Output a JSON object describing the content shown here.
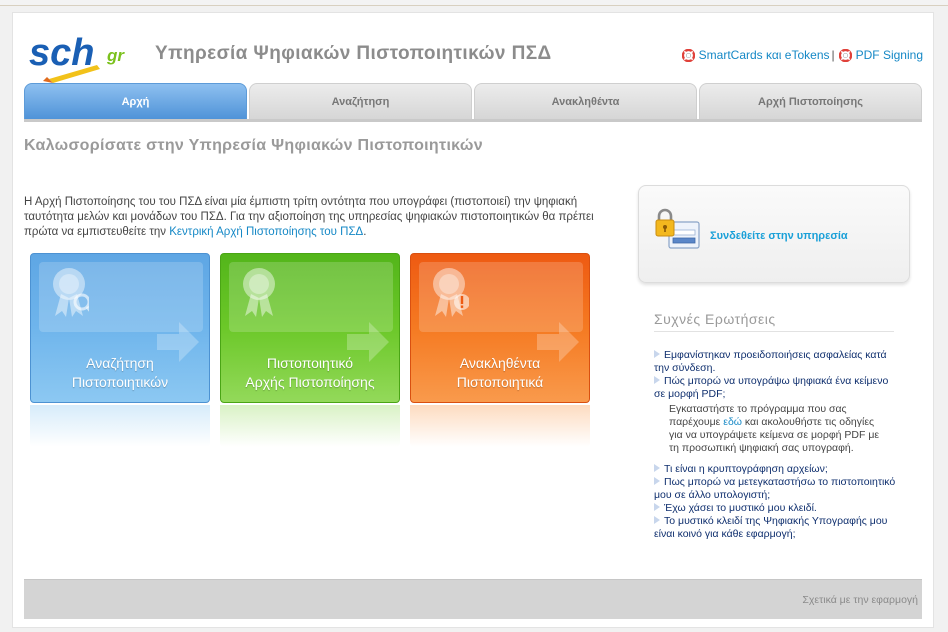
{
  "header": {
    "logo_text": "sch",
    "logo_suffix": "gr",
    "site_title": "Υπηρεσία Ψηφιακών Πιστοποιητικών ΠΣΔ",
    "links": {
      "smartcards": "SmartCards και eTokens",
      "separator": "|",
      "pdf_signing": "PDF Signing"
    }
  },
  "tabs": [
    {
      "label": "Αρχή",
      "active": true
    },
    {
      "label": "Αναζήτηση",
      "active": false
    },
    {
      "label": "Ανακληθέντα",
      "active": false
    },
    {
      "label": "Αρχή Πιστοποίησης",
      "active": false
    }
  ],
  "main": {
    "welcome": "Καλωσορίσατε στην Υπηρεσία Ψηφιακών Πιστοποιητικών",
    "intro_text": "Η Αρχή Πιστοποίησης του του ΠΣΔ είναι μία έμπιστη τρίτη οντότητα που υπογράφει (πιστοποιεί) την ψηφιακή ταυτότητα μελών και μονάδων του ΠΣΔ. Για την αξιοποίηση της υπηρεσίας ψηφιακών πιστοποιητικών θα πρέπει πρώτα να εμπιστευθείτε την ",
    "intro_link": "Κεντρική Αρχή Πιστοποίησης του ΠΣΔ",
    "intro_end": ".",
    "tiles": [
      {
        "line1": "Αναζήτηση",
        "line2": "Πιστοποιητικών",
        "color": "#5ea6e4"
      },
      {
        "line1": "Πιστοποιητικό",
        "line2": "Αρχής Πιστοποίησης",
        "color": "#53b51a"
      },
      {
        "line1": "Ανακληθέντα",
        "line2": "Πιστοποιητικά",
        "color": "#ee5a12"
      }
    ]
  },
  "sidebar": {
    "login_link": "Συνδεθείτε στην υπηρεσία",
    "faq_title": "Συχνές Ερωτήσεις",
    "faq": {
      "q1": "Εμφανίστηκαν προειδοποιήσεις ασφαλείας κατά την σύνδεση.",
      "q2": "Πώς μπορώ να υπογράψω ψηφιακά ένα κείμενο σε μορφή PDF;",
      "a2_pre": "Εγκαταστήστε το πρόγραμμα που σας παρέχουμε ",
      "a2_link": "εδώ",
      "a2_post": " και ακολουθήστε τις οδηγίες για να υπογράψετε κείμενα σε μορφή PDF με τη προσωπική ψηφιακή σας υπογραφή.",
      "q3": "Τι είναι η κρυπτογράφηση αρχείων;",
      "q4": "Πως μπορώ να μετεγκαταστήσω το πιστοποιητικό μου σε άλλο υπολογιστή;",
      "q5": "Έχω χάσει το μυστικό μου κλειδί.",
      "q6": "Το μυστικό κλειδί της Ψηφιακής Υπογραφής μου είναι κοινό για κάθε εφαρμογή;"
    }
  },
  "footer": {
    "about_link": "Σχετικά με την εφαρμογή"
  },
  "colors": {
    "accent": "#1588c6",
    "tab_active": "#4f93d8",
    "faq_text": "#0f2f6e"
  }
}
